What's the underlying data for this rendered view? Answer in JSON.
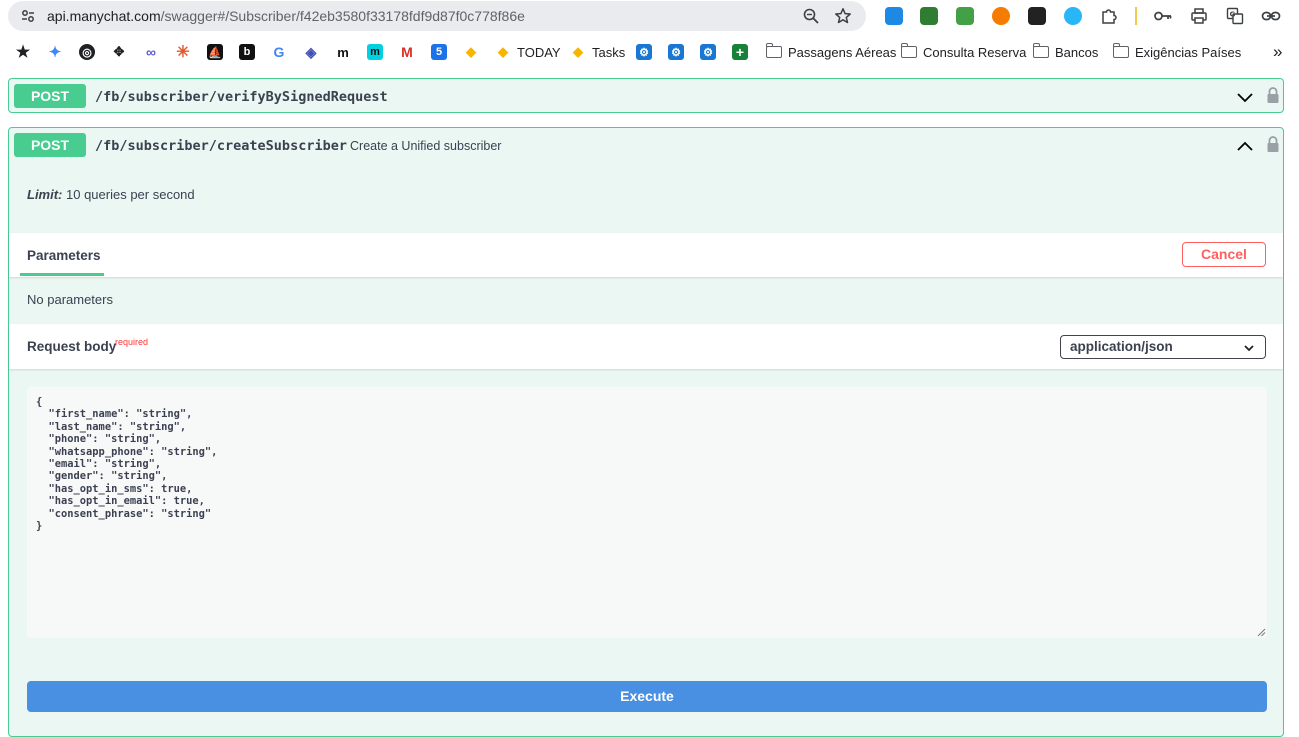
{
  "browser": {
    "url_host": "api.manychat.com",
    "url_rest": "/swagger#/Subscriber/f42eb3580f33178fdf9d87f0c778f86e",
    "bookmarks": [
      {
        "label": "TODAY"
      },
      {
        "label": "Tasks"
      },
      {
        "label": "Passagens Aéreas"
      },
      {
        "label": "Consulta Reserva"
      },
      {
        "label": "Bancos"
      },
      {
        "label": "Exigências Países"
      }
    ],
    "more_label": "»"
  },
  "operations": [
    {
      "method": "POST",
      "path": "/fb/subscriber/verifyBySignedRequest",
      "summary": ""
    },
    {
      "method": "POST",
      "path": "/fb/subscriber/createSubscriber",
      "summary": "Create a Unified subscriber"
    }
  ],
  "limit": {
    "label": "Limit:",
    "text": " 10 queries per second"
  },
  "parameters": {
    "tab_label": "Parameters",
    "cancel_label": "Cancel",
    "empty_text": "No parameters"
  },
  "request_body": {
    "title": "Request body",
    "required_label": "required",
    "content_type": "application/json",
    "json_text": "{\n  \"first_name\": \"string\",\n  \"last_name\": \"string\",\n  \"phone\": \"string\",\n  \"whatsapp_phone\": \"string\",\n  \"email\": \"string\",\n  \"gender\": \"string\",\n  \"has_opt_in_sms\": true,\n  \"has_opt_in_email\": true,\n  \"consent_phrase\": \"string\"\n}"
  },
  "execute_label": "Execute",
  "colors": {
    "post": "#49cc90",
    "post_bg": "#ebf7f2",
    "cancel": "#ff6060",
    "execute": "#4990e2"
  }
}
